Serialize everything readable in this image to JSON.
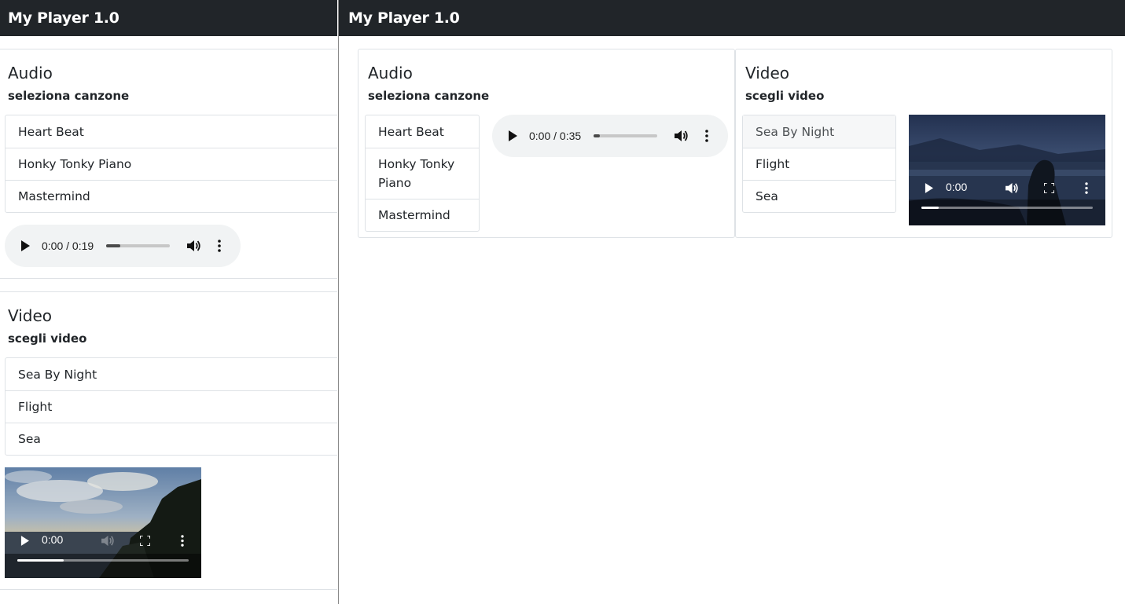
{
  "left": {
    "brand": "My Player 1.0",
    "audio": {
      "title": "Audio",
      "subtitle": "seleziona canzone",
      "songs": [
        "Heart Beat",
        "Honky Tonky Piano",
        "Mastermind"
      ],
      "player": {
        "time": "0:00 / 0:19",
        "progress": 0.22
      }
    },
    "video": {
      "title": "Video",
      "subtitle": "scegli video",
      "items": [
        "Sea By Night",
        "Flight",
        "Sea"
      ],
      "player": {
        "time": "0:00",
        "progress": 0.27
      }
    }
  },
  "right": {
    "brand": "My Player 1.0",
    "audio": {
      "title": "Audio",
      "subtitle": "seleziona canzone",
      "songs": [
        "Heart Beat",
        "Honky Tonky Piano",
        "Mastermind"
      ],
      "song_lines": [
        [
          "Heart Beat"
        ],
        [
          "Honky Tonky",
          "Piano"
        ],
        [
          "Mastermind"
        ]
      ],
      "player": {
        "time": "0:00 / 0:35",
        "progress": 0.1
      }
    },
    "video": {
      "title": "Video",
      "subtitle": "scegli video",
      "items": [
        "Sea By Night",
        "Flight",
        "Sea"
      ],
      "active_item": "Sea By Night",
      "player": {
        "time": "0:00",
        "progress": 0.1
      }
    }
  },
  "icons": {
    "play": "play-icon",
    "volume": "volume-icon",
    "more": "more-vert-icon",
    "fullscreen": "fullscreen-icon"
  },
  "colors": {
    "navbar": "#212529",
    "border": "#dee2e6",
    "player_bg": "#f1f3f4",
    "active_item_bg": "#f6f7f8"
  }
}
